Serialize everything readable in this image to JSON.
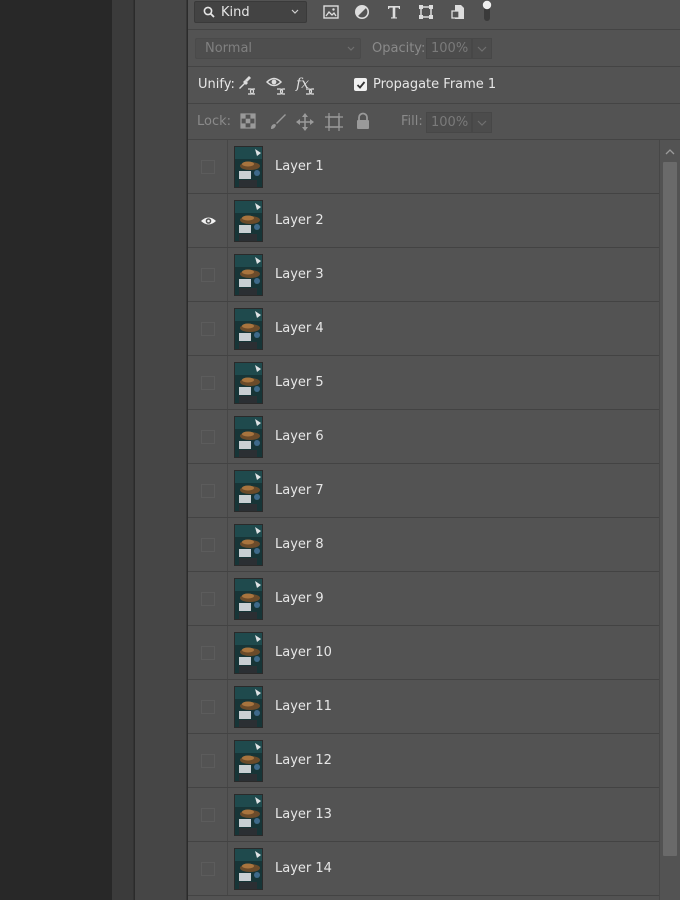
{
  "filter": {
    "kind_label": "Kind",
    "filter_icons": [
      "image-filter-icon",
      "adjustment-filter-icon",
      "type-filter-icon",
      "shape-filter-icon",
      "smart-object-filter-icon",
      "filter-toggle-icon"
    ]
  },
  "blend": {
    "mode": "Normal",
    "opacity_label": "Opacity:",
    "opacity_value": "100%"
  },
  "unify": {
    "label": "Unify:",
    "propagate_label": "Propagate Frame 1",
    "propagate_checked": true
  },
  "lock": {
    "label": "Lock:",
    "fill_label": "Fill:",
    "fill_value": "100%"
  },
  "layers": [
    {
      "name": "Layer 1",
      "visible": false
    },
    {
      "name": "Layer 2",
      "visible": true
    },
    {
      "name": "Layer 3",
      "visible": false
    },
    {
      "name": "Layer 4",
      "visible": false
    },
    {
      "name": "Layer 5",
      "visible": false
    },
    {
      "name": "Layer 6",
      "visible": false
    },
    {
      "name": "Layer 7",
      "visible": false
    },
    {
      "name": "Layer 8",
      "visible": false
    },
    {
      "name": "Layer 9",
      "visible": false
    },
    {
      "name": "Layer 10",
      "visible": false
    },
    {
      "name": "Layer 11",
      "visible": false
    },
    {
      "name": "Layer 12",
      "visible": false
    },
    {
      "name": "Layer 13",
      "visible": false
    },
    {
      "name": "Layer 14",
      "visible": false
    }
  ],
  "colors": {
    "panel_bg": "#535353",
    "text": "#e6e6e6",
    "disabled_text": "#8a8a8a"
  }
}
